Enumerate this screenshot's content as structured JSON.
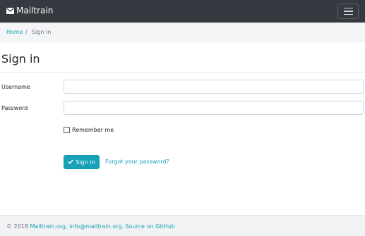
{
  "navbar": {
    "brand": "Mailtrain",
    "brand_icon": "envelope-icon",
    "toggler_icon": "hamburger-menu-icon"
  },
  "breadcrumb": {
    "home": "Home",
    "separator": "/",
    "current": "Sign in"
  },
  "page": {
    "title": "Sign in"
  },
  "form": {
    "username_label": "Username",
    "username_value": "",
    "password_label": "Password",
    "password_value": "",
    "remember_label": "Remember me",
    "remember_checked": false,
    "submit_label": "Sign in",
    "submit_icon": "checkmark-icon",
    "forgot_label": "Forgot your password?"
  },
  "footer": {
    "copyright": "© 2018",
    "link1": "Mailtrain.org",
    "comma": ",",
    "link2": "info@mailtrain.org",
    "period": ".",
    "link3": "Source on GitHub"
  },
  "colors": {
    "navbar_bg": "#343a40",
    "accent": "#17a2b8",
    "breadcrumb_bg": "#f4f5f6",
    "footer_bg": "#f1f2f4"
  }
}
